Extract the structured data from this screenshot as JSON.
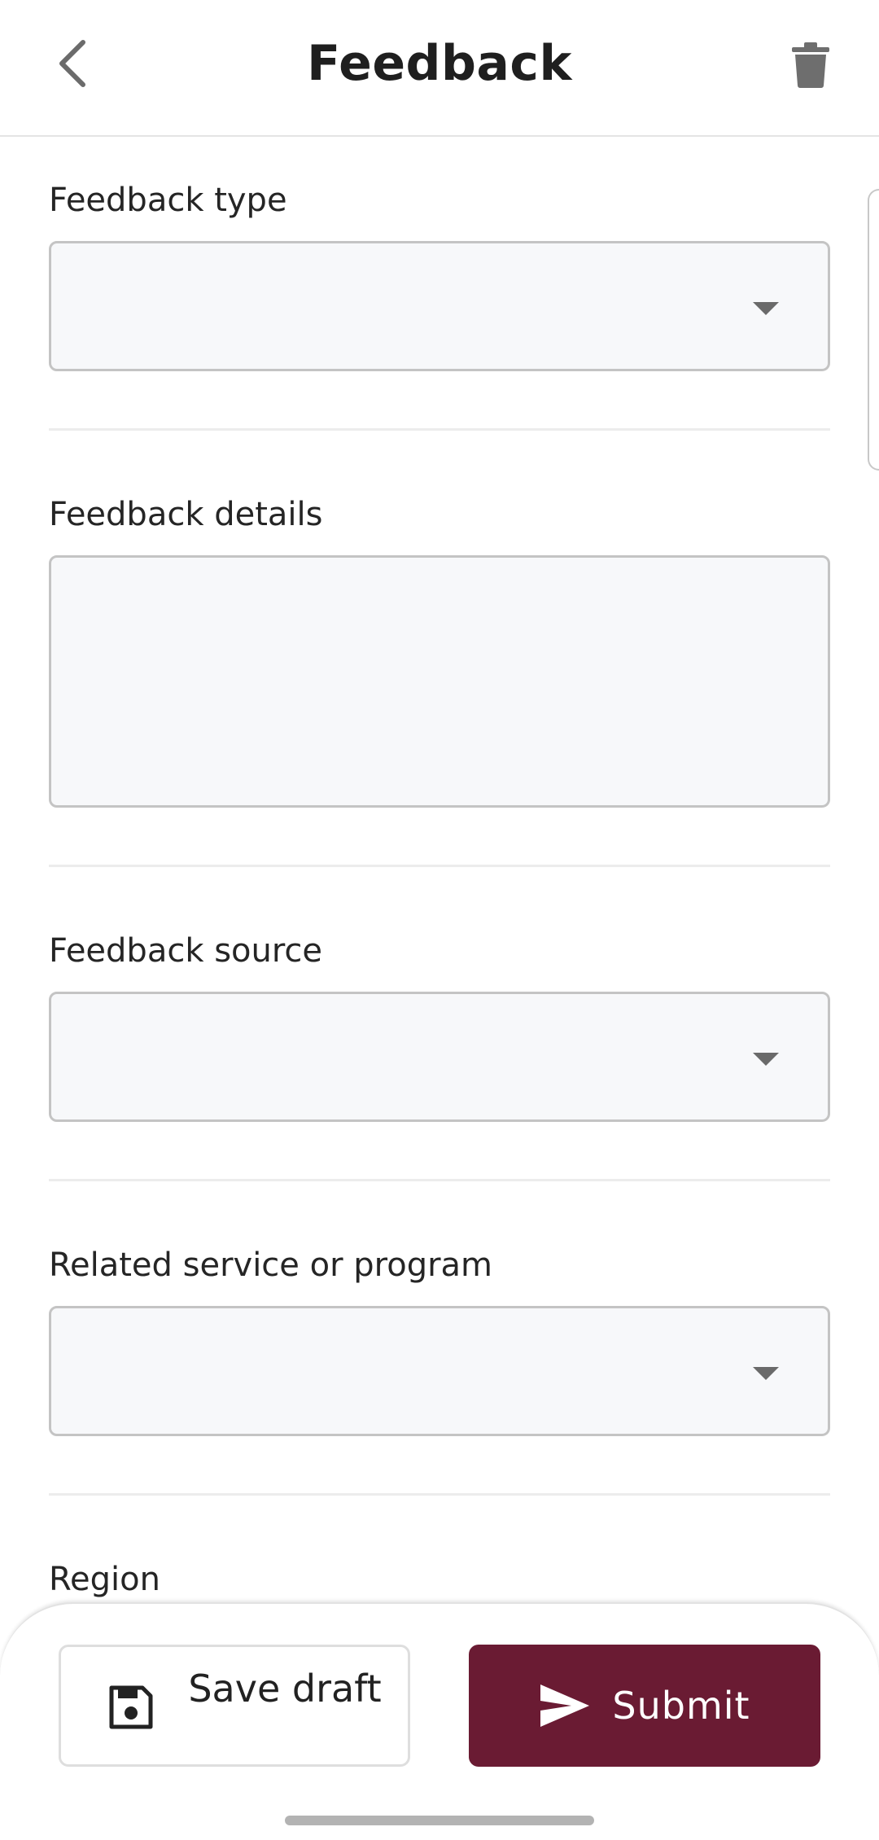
{
  "header": {
    "title": "Feedback",
    "back_icon": "chevron-left-icon",
    "delete_icon": "trash-icon"
  },
  "form": {
    "feedback_type": {
      "label": "Feedback type",
      "value": ""
    },
    "feedback_details": {
      "label": "Feedback details",
      "value": ""
    },
    "feedback_source": {
      "label": "Feedback source",
      "value": ""
    },
    "related_service": {
      "label": "Related service or program",
      "value": ""
    },
    "region": {
      "label": "Region"
    }
  },
  "actions": {
    "save_label": "Save draft",
    "save_icon": "floppy-disk-icon",
    "submit_label": "Submit",
    "submit_icon": "send-icon"
  },
  "colors": {
    "primary": "#6a1b33",
    "field_background": "#f7f8fa",
    "field_border": "#c4c4c4"
  }
}
